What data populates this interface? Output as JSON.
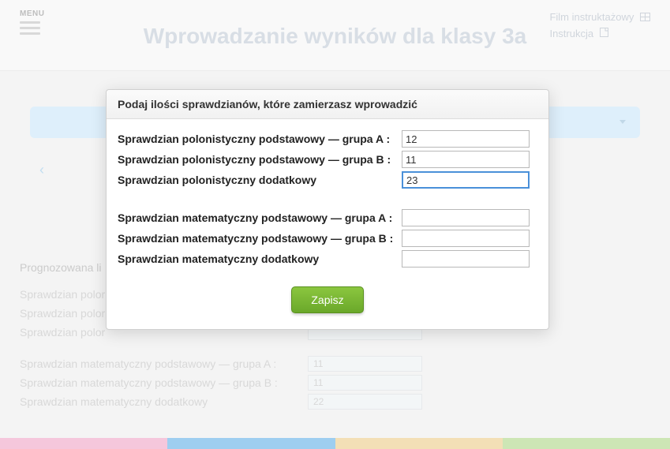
{
  "header": {
    "menu_label": "MENU",
    "title": "Wprowadzanie wyników dla klasy 3a",
    "link_video": "Film instruktażowy",
    "link_instr": "Instrukcja"
  },
  "bg": {
    "section_label": "Prognozowana li",
    "rows1": [
      {
        "label": "Sprawdzian polor",
        "value": ""
      },
      {
        "label": "Sprawdzian polor",
        "value": ""
      },
      {
        "label": "Sprawdzian polor",
        "value": ""
      }
    ],
    "rows2": [
      {
        "label": "Sprawdzian matematyczny podstawowy — grupa A :",
        "value": "11"
      },
      {
        "label": "Sprawdzian matematyczny podstawowy — grupa B :",
        "value": "11"
      },
      {
        "label": "Sprawdzian matematyczny dodatkowy",
        "value": "22"
      }
    ]
  },
  "modal": {
    "title": "Podaj ilości sprawdzianów, które zamierzasz wprowadzić",
    "group1": [
      {
        "label": "Sprawdzian polonistyczny podstawowy — grupa A :",
        "value": "12"
      },
      {
        "label": "Sprawdzian polonistyczny podstawowy — grupa B :",
        "value": "11"
      },
      {
        "label": "Sprawdzian polonistyczny dodatkowy",
        "value": "23",
        "focused": true
      }
    ],
    "group2": [
      {
        "label": "Sprawdzian matematyczny podstawowy — grupa A :",
        "value": ""
      },
      {
        "label": "Sprawdzian matematyczny podstawowy — grupa B :",
        "value": ""
      },
      {
        "label": "Sprawdzian matematyczny dodatkowy",
        "value": ""
      }
    ],
    "save_label": "Zapisz"
  }
}
